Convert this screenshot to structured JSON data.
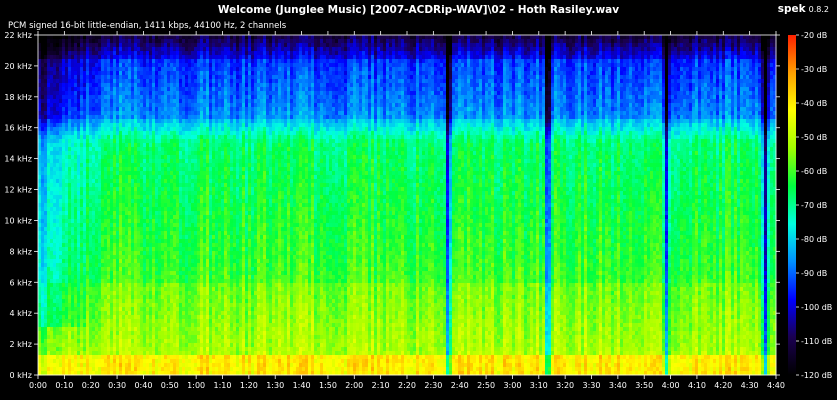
{
  "header": {
    "title": "Welcome (Junglee Music) [2007-ACDRip-WAV]\\02 - Hoth Rasiley.wav",
    "app_name": "spek",
    "app_version": "0.8.2",
    "file_info": "PCM signed 16-bit little-endian, 1411 kbps, 44100 Hz, 2 channels"
  },
  "chart_data": {
    "type": "heatmap",
    "subtype": "spectrogram",
    "duration_seconds": 280,
    "x_ticks": [
      "0:00",
      "0:10",
      "0:20",
      "0:30",
      "0:40",
      "0:50",
      "1:00",
      "1:10",
      "1:20",
      "1:30",
      "1:40",
      "1:50",
      "2:00",
      "2:10",
      "2:20",
      "2:30",
      "2:40",
      "2:50",
      "3:00",
      "3:10",
      "3:20",
      "3:30",
      "3:40",
      "3:50",
      "4:00",
      "4:10",
      "4:20",
      "4:30",
      "4:40"
    ],
    "y_ticks": [
      "0 kHz",
      "2 kHz",
      "4 kHz",
      "6 kHz",
      "8 kHz",
      "10 kHz",
      "12 kHz",
      "14 kHz",
      "16 kHz",
      "18 kHz",
      "20 kHz",
      "22 kHz"
    ],
    "ylim_khz": [
      0,
      22
    ],
    "color_scale_ticks": [
      "-20 dB",
      "-30 dB",
      "-40 dB",
      "-50 dB",
      "-60 dB",
      "-70 dB",
      "-80 dB",
      "-90 dB",
      "-100 dB",
      "-110 dB",
      "-120 dB"
    ],
    "color_scale_range_db": [
      -120,
      -20
    ],
    "colormap": [
      "#000000",
      "#1a0050",
      "#0000ff",
      "#0090ff",
      "#00ffe0",
      "#00ff40",
      "#a0ff00",
      "#ffff00",
      "#ffa000",
      "#ff2000"
    ],
    "notable_gaps_seconds": [
      155.5,
      193.5,
      238.5,
      276
    ]
  }
}
